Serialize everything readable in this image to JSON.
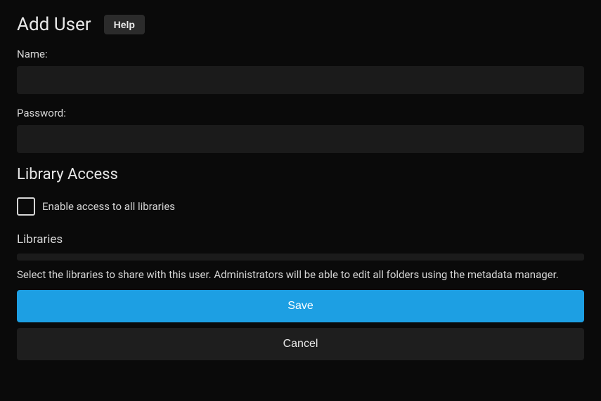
{
  "header": {
    "title": "Add User",
    "help_label": "Help"
  },
  "form": {
    "name_label": "Name:",
    "name_value": "",
    "password_label": "Password:",
    "password_value": ""
  },
  "library": {
    "section_heading": "Library Access",
    "enable_all_label": "Enable access to all libraries",
    "enable_all_checked": false,
    "libraries_heading": "Libraries",
    "help_text": "Select the libraries to share with this user. Administrators will be able to edit all folders using the metadata manager."
  },
  "buttons": {
    "save": "Save",
    "cancel": "Cancel"
  },
  "colors": {
    "accent": "#1d9fe3",
    "bg": "#0a0a0a",
    "input_bg": "#1b1b1b",
    "text": "#dcdcdc"
  }
}
